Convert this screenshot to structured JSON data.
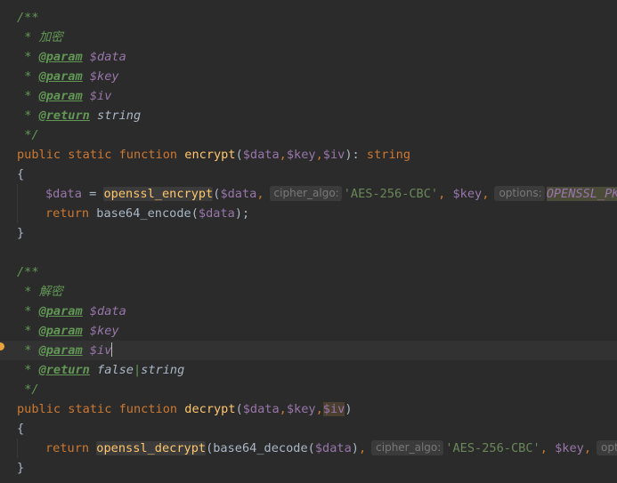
{
  "editor": {
    "block1": {
      "doc_open": "/**",
      "doc_star": "*",
      "doc_summary": "加密",
      "param_tag": "@param",
      "return_tag": "@return",
      "param1": "$data",
      "param2": "$key",
      "param3": "$iv",
      "return_type": "string",
      "doc_close": "*/",
      "kw_public": "public",
      "kw_static": "static",
      "kw_function": "function",
      "fn_name": "encrypt",
      "sig_params_open": "(",
      "sig_p1": "$data",
      "comma": ",",
      "sig_p2": "$key",
      "sig_p3": "$iv",
      "sig_close": "):",
      "sig_return": "string",
      "brace_open": "{",
      "brace_close": "}",
      "l1_var": "$data",
      "l1_assign": " = ",
      "l1_call": "openssl_encrypt",
      "l1_paren": "(",
      "l1_arg1": "$data",
      "l1_hint1": "cipher_algo:",
      "l1_str": "'AES-256-CBC'",
      "l1_arg3": "$key",
      "l1_hint2": "options:",
      "l1_const": "OPENSSL_PK",
      "l2_kw": "return",
      "l2_call": "base64_encode",
      "l2_arg": "$data",
      "l2_end": ");"
    },
    "block2": {
      "doc_open": "/**",
      "doc_star": "*",
      "doc_summary": "解密",
      "param_tag": "@param",
      "return_tag": "@return",
      "param1": "$data",
      "param2": "$key",
      "param3": "$iv",
      "return_type_a": "false",
      "return_bar": "|",
      "return_type_b": "string",
      "doc_close": "*/",
      "kw_public": "public",
      "kw_static": "static",
      "kw_function": "function",
      "fn_name": "decrypt",
      "sig_open": "(",
      "sig_p1": "$data",
      "comma": ",",
      "sig_p2": "$key",
      "sig_p3": "$iv",
      "sig_close": ")",
      "brace_open": "{",
      "brace_close": "}",
      "l1_kw": "return",
      "l1_call": "openssl_decrypt",
      "l1_paren": "(",
      "l1_inner_call": "base64_decode",
      "l1_inner_arg": "$data",
      "l1_inner_close": ")",
      "l1_hint1": "cipher_algo:",
      "l1_str": "'AES-256-CBC'",
      "l1_arg3": "$key",
      "l1_hint2": "opti"
    },
    "gutter_icon": "bulb-icon",
    "colors": {
      "background": "#2b2b2b",
      "keyword": "#cc7832",
      "function": "#ffc66d",
      "variable": "#9876aa",
      "string": "#6a8759",
      "doc_comment": "#629755",
      "text": "#a9b7c6"
    }
  }
}
